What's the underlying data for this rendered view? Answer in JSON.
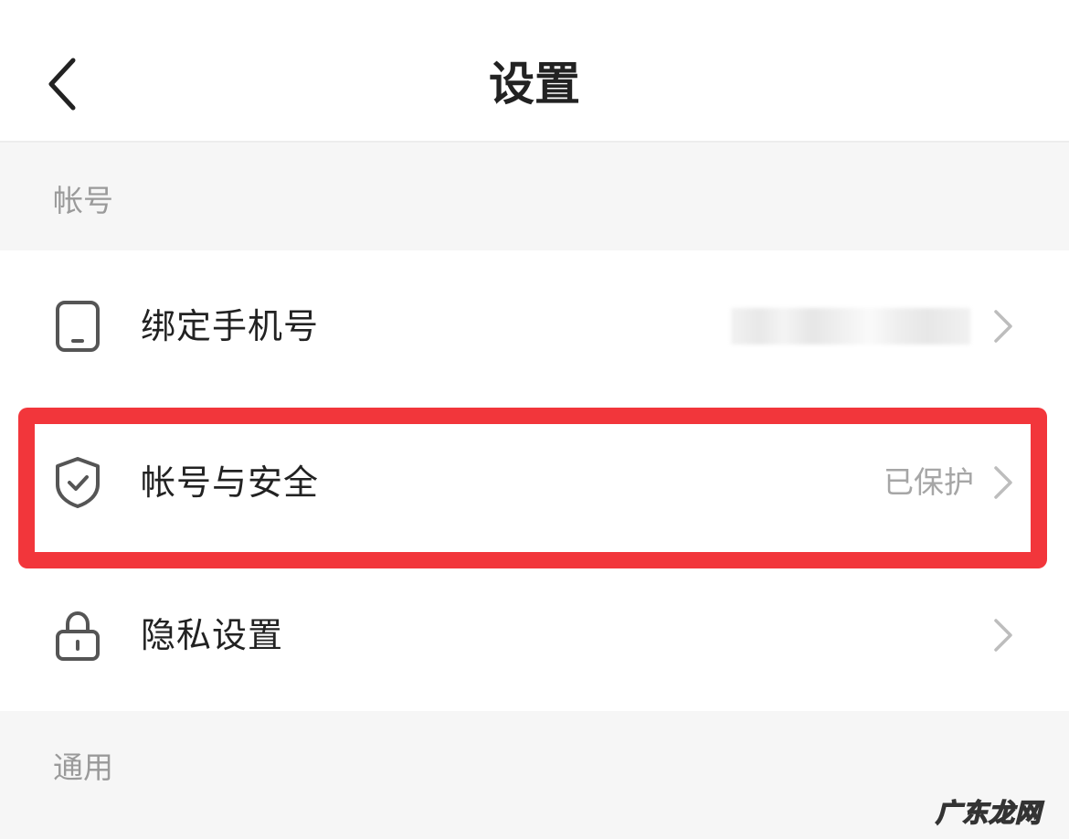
{
  "header": {
    "title": "设置",
    "back_icon": "chevron-left-icon"
  },
  "sections": {
    "account": {
      "title": "帐号",
      "rows": [
        {
          "label": "绑定手机号",
          "value": "",
          "value_obscured": true,
          "icon": "phone-icon"
        },
        {
          "label": "帐号与安全",
          "value": "已保护",
          "icon": "shield-check-icon",
          "highlighted": true
        },
        {
          "label": "隐私设置",
          "value": "",
          "icon": "lock-icon"
        }
      ]
    },
    "general": {
      "title": "通用"
    }
  },
  "colors": {
    "highlight": "#f2363b",
    "section_bg": "#f6f6f6",
    "text_primary": "#222222",
    "text_secondary": "#a6a6a6"
  },
  "watermark": "广东龙网"
}
